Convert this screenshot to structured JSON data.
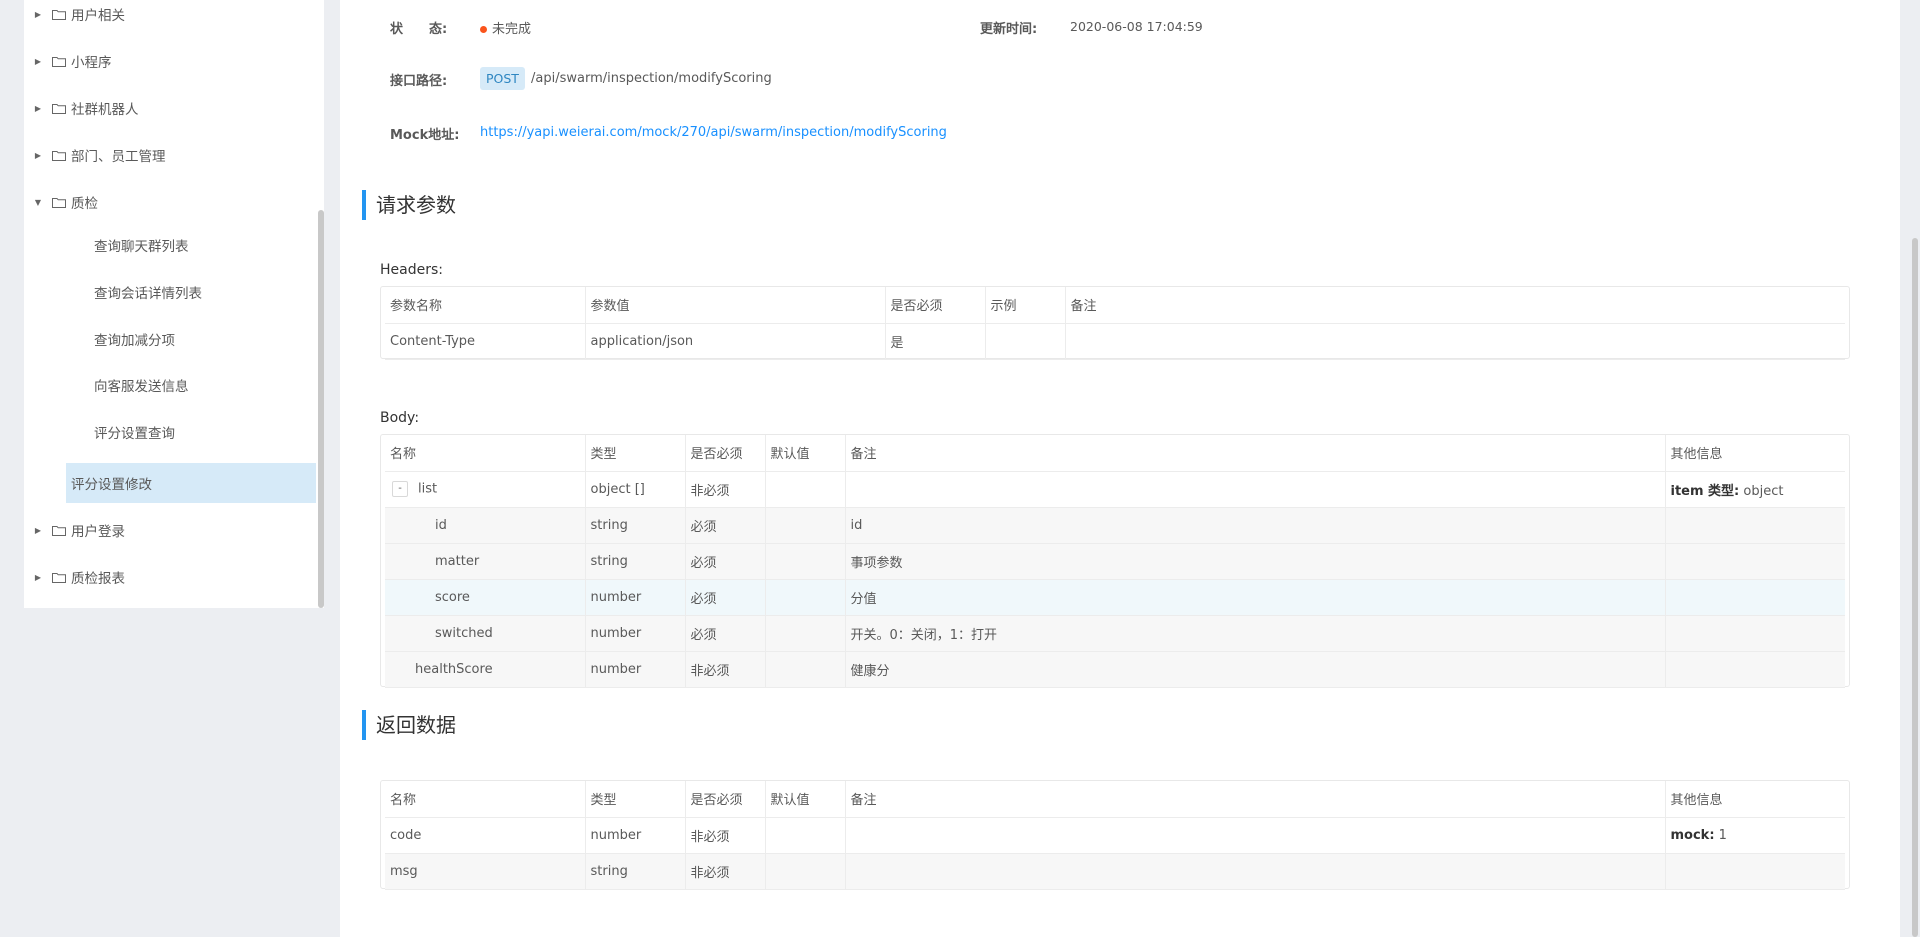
{
  "sidebar": {
    "folders_top": [
      {
        "label": "用户相关",
        "expanded": false
      },
      {
        "label": "小程序",
        "expanded": false
      },
      {
        "label": "社群机器人",
        "expanded": false
      },
      {
        "label": "部门、员工管理",
        "expanded": false
      },
      {
        "label": "质检",
        "expanded": true
      }
    ],
    "children": [
      "查询聊天群列表",
      "查询会话详情列表",
      "查询加减分项",
      "向客服发送信息",
      "评分设置查询",
      "评分设置修改"
    ],
    "active_child": "评分设置修改",
    "folders_bottom": [
      {
        "label": "用户登录",
        "expanded": false
      },
      {
        "label": "质检报表",
        "expanded": false
      }
    ]
  },
  "info": {
    "status_label": "状　　态:",
    "status_value": "未完成",
    "update_label": "更新时间:",
    "update_value": "2020-06-08 17:04:59",
    "path_label": "接口路径:",
    "method": "POST",
    "path": "/api/swarm/inspection/modifyScoring",
    "mock_label": "Mock地址:",
    "mock_url": "https://yapi.weierai.com/mock/270/api/swarm/inspection/modifyScoring"
  },
  "request": {
    "title": "请求参数",
    "headers_title": "Headers:",
    "headers_cols": [
      "参数名称",
      "参数值",
      "是否必须",
      "示例",
      "备注"
    ],
    "headers_rows": [
      [
        "Content-Type",
        "application/json",
        "是",
        "",
        ""
      ]
    ],
    "body_title": "Body:",
    "body_cols": [
      "名称",
      "类型",
      "是否必须",
      "默认值",
      "备注",
      "其他信息"
    ],
    "body_rows": [
      {
        "name": "list",
        "type": "object []",
        "required": "非必须",
        "default": "",
        "note": "",
        "other_key": "item 类型:",
        "other_val": "object",
        "level": 0,
        "expand": "-"
      },
      {
        "name": "id",
        "type": "string",
        "required": "必须",
        "default": "",
        "note": "id",
        "other_key": "",
        "other_val": "",
        "level": 1
      },
      {
        "name": "matter",
        "type": "string",
        "required": "必须",
        "default": "",
        "note": "事项参数",
        "other_key": "",
        "other_val": "",
        "level": 1
      },
      {
        "name": "score",
        "type": "number",
        "required": "必须",
        "default": "",
        "note": "分值",
        "other_key": "",
        "other_val": "",
        "level": 1
      },
      {
        "name": "switched",
        "type": "number",
        "required": "必须",
        "default": "",
        "note": "开关。0：关闭，1：打开",
        "other_key": "",
        "other_val": "",
        "level": 1
      },
      {
        "name": "healthScore",
        "type": "number",
        "required": "非必须",
        "default": "",
        "note": "健康分",
        "other_key": "",
        "other_val": "",
        "level": 0
      }
    ]
  },
  "response": {
    "title": "返回数据",
    "cols": [
      "名称",
      "类型",
      "是否必须",
      "默认值",
      "备注",
      "其他信息"
    ],
    "rows": [
      {
        "name": "code",
        "type": "number",
        "required": "非必须",
        "default": "",
        "note": "",
        "other_key": "mock:",
        "other_val": "1"
      },
      {
        "name": "msg",
        "type": "string",
        "required": "非必须",
        "default": "",
        "note": "",
        "other_key": "",
        "other_val": ""
      }
    ]
  }
}
